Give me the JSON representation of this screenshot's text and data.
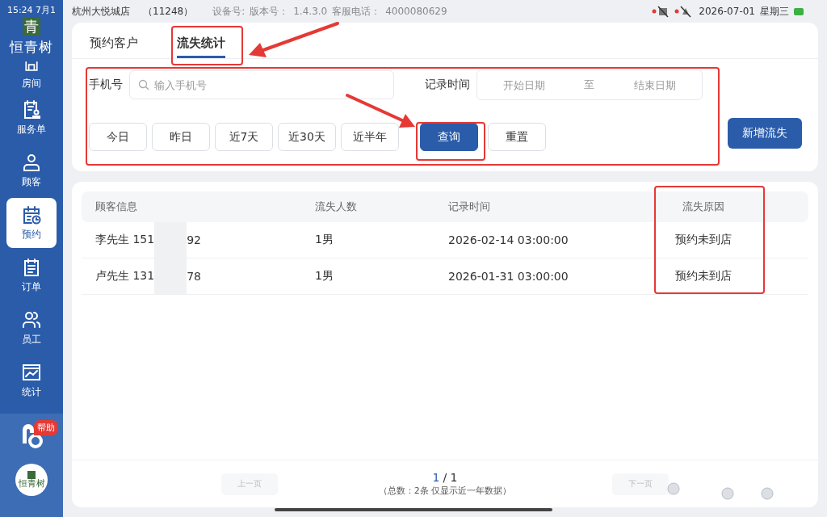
{
  "status_bar": {
    "time": "15:24 7月1",
    "store": "杭州大悦城店",
    "store_id": "（11248）",
    "device_label": "设备号:",
    "version_label": "版本号：",
    "version": "1.4.3.0",
    "hotline_label": "客服电话：",
    "hotline": "4000080629",
    "date": "2026-07-01",
    "weekday": "星期三"
  },
  "sidebar": {
    "brand_char": "青",
    "brand_name": "恒青树",
    "items": [
      {
        "label": "房间",
        "kind": "room",
        "selected": false
      },
      {
        "label": "服务单",
        "kind": "service",
        "selected": false
      },
      {
        "label": "顾客",
        "kind": "customer",
        "selected": false
      },
      {
        "label": "预约",
        "kind": "booking",
        "selected": true
      },
      {
        "label": "订单",
        "kind": "order",
        "selected": false
      },
      {
        "label": "员工",
        "kind": "staff",
        "selected": false
      },
      {
        "label": "统计",
        "kind": "stats",
        "selected": false
      }
    ],
    "help_badge": "帮助",
    "footer_logo_text": "恒青树"
  },
  "tabs": [
    {
      "label": "预约客户",
      "selected": false
    },
    {
      "label": "流失统计",
      "selected": true
    }
  ],
  "filters": {
    "phone_label": "手机号",
    "phone_placeholder": "输入手机号",
    "time_label": "记录时间",
    "start_placeholder": "开始日期",
    "separator": "至",
    "end_placeholder": "结束日期",
    "quick": [
      "今日",
      "昨日",
      "近7天",
      "近30天",
      "近半年"
    ],
    "query": "查询",
    "reset": "重置"
  },
  "add_button": "新增流失",
  "table": {
    "columns": [
      "顾客信息",
      "流失人数",
      "记录时间",
      "流失原因"
    ],
    "rows": [
      {
        "customer_prefix": "李先生 151",
        "customer_suffix": "92",
        "count": "1男",
        "time": "2026-02-14 03:00:00",
        "reason": "预约未到店"
      },
      {
        "customer_prefix": "卢先生 131",
        "customer_suffix": "78",
        "count": "1男",
        "time": "2026-01-31 03:00:00",
        "reason": "预约未到店"
      }
    ]
  },
  "pagination": {
    "prev": "上一页",
    "prev_disabled": true,
    "current": "1",
    "rest": "/ 1",
    "summary": "（总数：2条 仅显示近一年数据）",
    "next": "下一页",
    "next_disabled": true
  }
}
